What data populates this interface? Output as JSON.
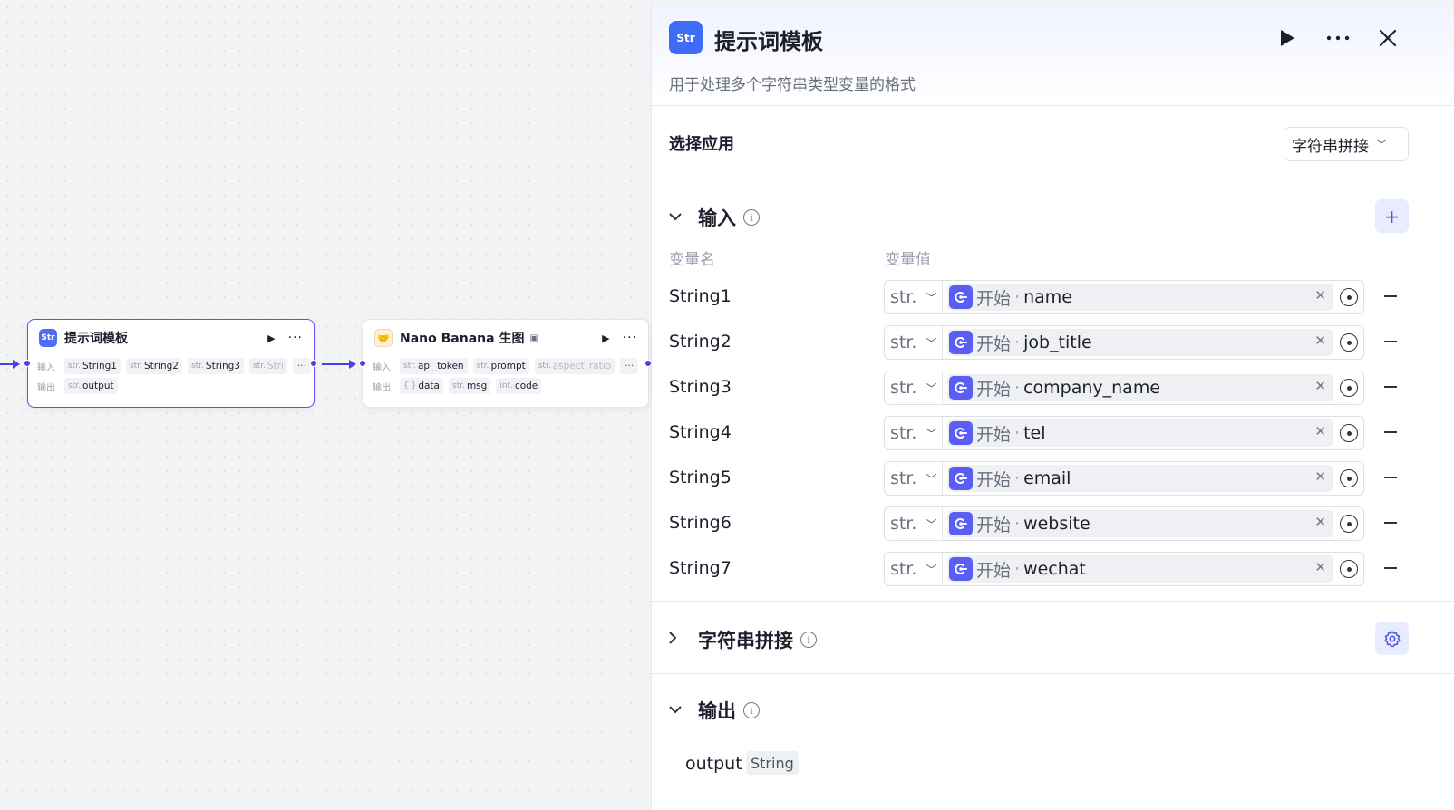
{
  "canvas": {
    "node1": {
      "title": "提示词模板",
      "icon_text": "Str",
      "input_label": "输入",
      "output_label": "输出",
      "inputs": [
        {
          "type": "str.",
          "name": "String1"
        },
        {
          "type": "str.",
          "name": "String2"
        },
        {
          "type": "str.",
          "name": "String3"
        },
        {
          "type": "str.",
          "name": "Stri"
        }
      ],
      "outputs": [
        {
          "type": "str.",
          "name": "output"
        }
      ],
      "more": "···"
    },
    "node2": {
      "title": "Nano Banana 生图",
      "icon_text": "🤝",
      "input_label": "输入",
      "output_label": "输出",
      "inputs": [
        {
          "type": "str.",
          "name": "api_token"
        },
        {
          "type": "str.",
          "name": "prompt"
        },
        {
          "type": "str.",
          "name": "aspect_ratio"
        }
      ],
      "outputs": [
        {
          "type": "{ }",
          "name": "data"
        },
        {
          "type": "str.",
          "name": "msg"
        },
        {
          "type": "int.",
          "name": "code"
        }
      ],
      "more": "···"
    }
  },
  "panel": {
    "icon_text": "Str",
    "title": "提示词模板",
    "description": "用于处理多个字符串类型变量的格式",
    "select_app": {
      "label": "选择应用",
      "value": "字符串拼接"
    },
    "input_section": {
      "title": "输入",
      "col_name": "变量名",
      "col_value": "变量值",
      "rows": [
        {
          "name": "String1",
          "type": "str.",
          "source": "开始",
          "value": "name"
        },
        {
          "name": "String2",
          "type": "str.",
          "source": "开始",
          "value": "job_title"
        },
        {
          "name": "String3",
          "type": "str.",
          "source": "开始",
          "value": "company_name"
        },
        {
          "name": "String4",
          "type": "str.",
          "source": "开始",
          "value": "tel"
        },
        {
          "name": "String5",
          "type": "str.",
          "source": "开始",
          "value": "email"
        },
        {
          "name": "String6",
          "type": "str.",
          "source": "开始",
          "value": "website"
        },
        {
          "name": "String7",
          "type": "str.",
          "source": "开始",
          "value": "wechat"
        }
      ]
    },
    "concat_section": {
      "title": "字符串拼接"
    },
    "output_section": {
      "title": "输出",
      "items": [
        {
          "name": "output",
          "type": "String"
        }
      ]
    }
  },
  "colors": {
    "accent": "#4e40e5",
    "node_icon": "#4e6cf5",
    "ref_icon": "#5b5ef2",
    "button_bg": "#e9ecff"
  }
}
